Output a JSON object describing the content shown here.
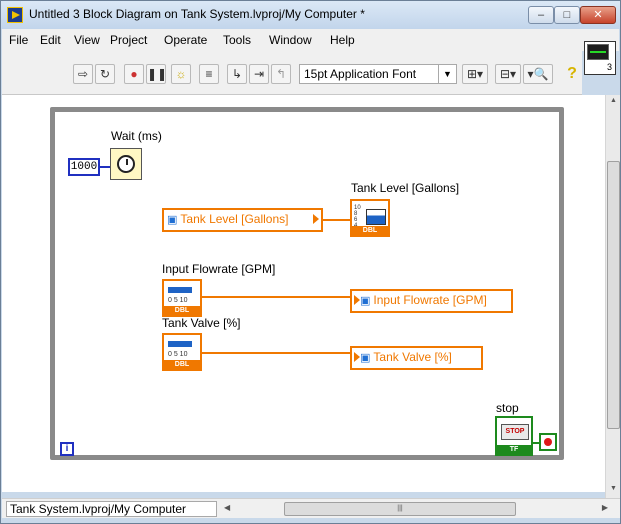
{
  "window": {
    "title": "Untitled 3 Block Diagram on Tank System.lvproj/My Computer *",
    "minimize_glyph": "–",
    "maximize_glyph": "□",
    "close_glyph": "✕"
  },
  "menu": [
    "File",
    "Edit",
    "View",
    "Project",
    "Operate",
    "Tools",
    "Window",
    "Help"
  ],
  "toolbar": {
    "font_selector": "15pt Application Font",
    "icons": [
      "run-arrow-icon",
      "run-continuously-icon",
      "abort-icon",
      "pause-icon",
      "highlight-execution-icon",
      "retain-wire-values-icon",
      "step-into-icon",
      "step-over-icon",
      "step-out-icon",
      "align-icon",
      "distribute-icon",
      "search-icon",
      "help-icon"
    ]
  },
  "vi_icon": {
    "number": "3"
  },
  "diagram": {
    "wait": {
      "label": "Wait (ms)",
      "constant": "1000"
    },
    "tank_level": {
      "label": "Tank Level [Gallons]",
      "variable": "Tank Level [Gallons]"
    },
    "input_flowrate": {
      "label": "Input Flowrate [GPM]",
      "variable": "Input Flowrate [GPM]"
    },
    "tank_valve": {
      "label": "Tank Valve [%]",
      "variable": "Tank Valve [%]"
    },
    "stop": {
      "label": "stop",
      "button_text": "STOP",
      "type_tag": "TF"
    },
    "loop_iteration": "i",
    "dbl_tag": "DBL",
    "slider_ticks": "0  5  10"
  },
  "status": {
    "context": "Tank System.lvproj/My Computer"
  },
  "colors": {
    "numeric_blue": "#2030c0",
    "dbl_orange": "#f07800",
    "boolean_green": "#1d8a1d",
    "loop_gray": "#8a8a8a"
  }
}
